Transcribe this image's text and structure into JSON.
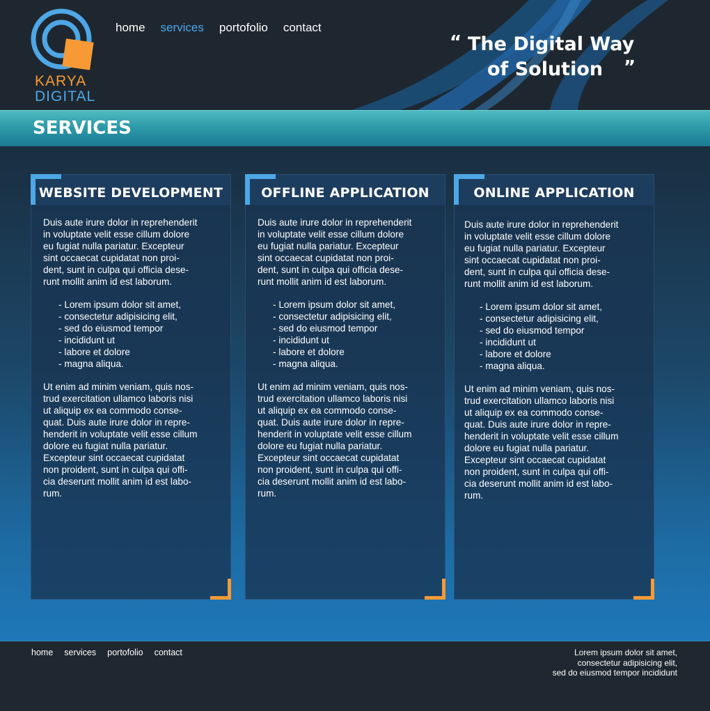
{
  "brand": {
    "name_line1": "KARYA",
    "name_line2": "DIGITAL",
    "logo": "karya-digital-logo",
    "colors": {
      "orange": "#f79a35",
      "blue": "#4ea7e6"
    }
  },
  "nav": {
    "items": [
      "home",
      "services",
      "portofolio",
      "contact"
    ],
    "active": "services"
  },
  "tagline": {
    "open_quote": "“",
    "line1": "The Digital Way",
    "line2": "of Solution",
    "close_quote": "”"
  },
  "section": {
    "title": "SERVICES"
  },
  "cards": [
    {
      "title": "WEBSITE DEVELOPMENT",
      "intro": "Duis aute irure dolor in reprehenderit\nin voluptate velit esse cillum dolore\neu fugiat nulla pariatur. Excepteur\nsint occaecat cupidatat non proi-\ndent, sunt in culpa qui officia dese-\nrunt mollit anim id est laborum.",
      "list": [
        "Lorem ipsum dolor sit amet,",
        "consectetur adipisicing elit,",
        "sed do eiusmod tempor",
        "incididunt ut",
        "labore et dolore",
        "magna aliqua."
      ],
      "outro": "Ut enim ad minim veniam, quis nos-\ntrud exercitation ullamco laboris nisi\nut aliquip ex ea commodo conse-\nquat. Duis aute irure dolor in repre-\nhenderit in voluptate velit esse cillum\ndolore eu fugiat nulla pariatur.\nExcepteur sint occaecat cupidatat\nnon proident, sunt in culpa qui offi-\ncia deserunt mollit anim id est labo-\nrum."
    },
    {
      "title": "OFFLINE APPLICATION",
      "intro": "Duis aute irure dolor in reprehenderit\nin voluptate velit esse cillum dolore\neu fugiat nulla pariatur. Excepteur\nsint occaecat cupidatat non proi-\ndent, sunt in culpa qui officia dese-\nrunt mollit anim id est laborum.",
      "list": [
        "Lorem ipsum dolor sit amet,",
        "consectetur adipisicing elit,",
        "sed do eiusmod tempor",
        "incididunt ut",
        "labore et dolore",
        "magna aliqua."
      ],
      "outro": "Ut enim ad minim veniam, quis nos-\ntrud exercitation ullamco laboris nisi\nut aliquip ex ea commodo conse-\nquat. Duis aute irure dolor in repre-\nhenderit in voluptate velit esse cillum\ndolore eu fugiat nulla pariatur.\nExcepteur sint occaecat cupidatat\nnon proident, sunt in culpa qui offi-\ncia deserunt mollit anim id est labo-\nrum."
    },
    {
      "title": "ONLINE APPLICATION",
      "intro": "Duis aute irure dolor in reprehenderit\nin voluptate velit esse cillum dolore\neu fugiat nulla pariatur. Excepteur\nsint occaecat cupidatat non proi-\ndent, sunt in culpa qui officia dese-\nrunt mollit anim id est laborum.",
      "list": [
        "Lorem ipsum dolor sit amet,",
        "consectetur adipisicing elit,",
        "sed do eiusmod tempor",
        "incididunt ut",
        "labore et dolore",
        "magna aliqua."
      ],
      "outro": "Ut enim ad minim veniam, quis nos-\ntrud exercitation ullamco laboris nisi\nut aliquip ex ea commodo conse-\nquat. Duis aute irure dolor in repre-\nhenderit in voluptate velit esse cillum\ndolore eu fugiat nulla pariatur.\nExcepteur sint occaecat cupidatat\nnon proident, sunt in culpa qui offi-\ncia deserunt mollit anim id est labo-\nrum."
    }
  ],
  "footer": {
    "nav": [
      "home",
      "services",
      "portofolio",
      "contact"
    ],
    "text": "Lorem ipsum dolor sit amet,\nconsectetur adipisicing elit,\nsed do eiusmod tempor incididunt"
  }
}
